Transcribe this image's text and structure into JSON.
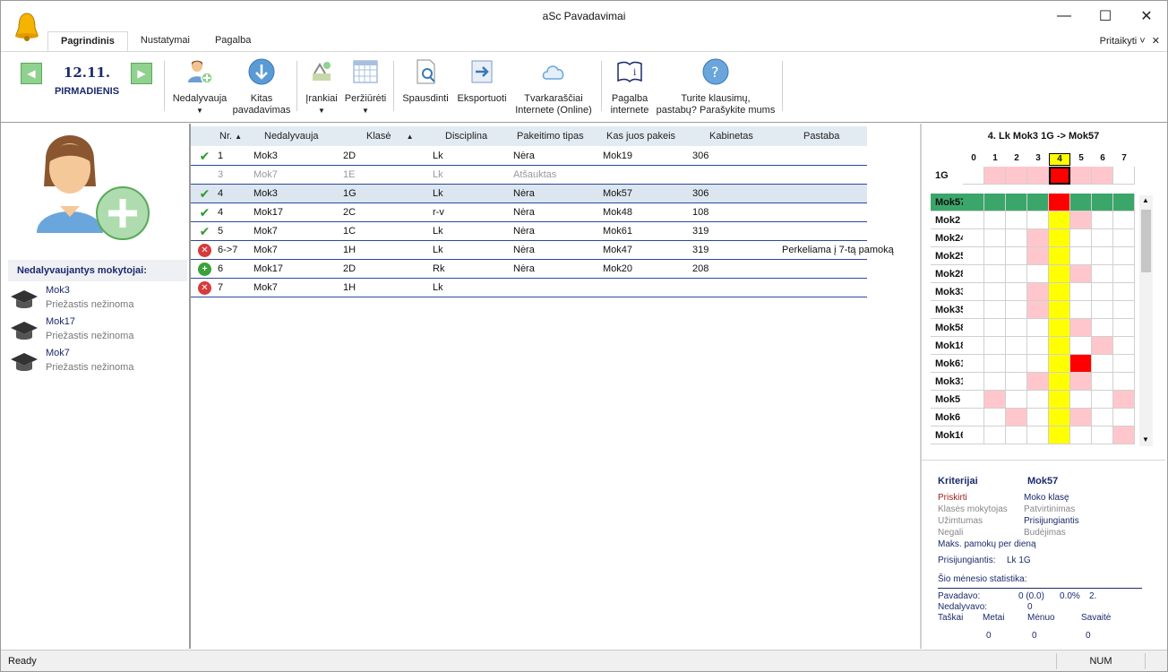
{
  "window": {
    "title": "aSc Pavadavimai"
  },
  "menu": {
    "tabs": [
      "Pagrindinis",
      "Nustatymai",
      "Pagalba"
    ],
    "customize": "Pritaikyti ˅"
  },
  "ribbon": {
    "date": "12.11.",
    "day": "PIRMADIENIS",
    "buttons": {
      "absent": "Nedalyvauja",
      "next_line1": "Kitas",
      "next_line2": "pavadavimas",
      "tools": "Įrankiai",
      "view": "Peržiūrėti",
      "print": "Spausdinti",
      "export": "Eksportuoti",
      "online_line1": "Tvarkaraščiai",
      "online_line2": "Internete (Online)",
      "help_line1": "Pagalba",
      "help_line2": "internete",
      "question_line1": "Turite klausimų,",
      "question_line2": "pastabų? Parašykite mums"
    }
  },
  "sidebar": {
    "title": "Nedalyvaujantys mokytojai:",
    "teachers": [
      {
        "name": "Mok3",
        "reason": "Priežastis nežinoma"
      },
      {
        "name": "Mok17",
        "reason": "Priežastis nežinoma"
      },
      {
        "name": "Mok7",
        "reason": "Priežastis nežinoma"
      }
    ]
  },
  "table": {
    "columns": [
      "Nr.",
      "Nedalyvauja",
      "Klasė",
      "Disciplina",
      "Pakeitimo tipas",
      "Kas juos pakeis",
      "Kabinetas",
      "Pastaba"
    ],
    "rows": [
      {
        "status": "ok",
        "nr": "1",
        "teacher": "Mok3",
        "class": "2D",
        "subject": "Lk",
        "type": "Nėra",
        "sub": "Mok19",
        "room": "306",
        "note": ""
      },
      {
        "status": "grey",
        "nr": "3",
        "teacher": "Mok7",
        "class": "1E",
        "subject": "Lk",
        "type": "Atšauktas",
        "sub": "",
        "room": "",
        "note": ""
      },
      {
        "status": "ok",
        "nr": "4",
        "teacher": "Mok3",
        "class": "1G",
        "subject": "Lk",
        "type": "Nėra",
        "sub": "Mok57",
        "room": "306",
        "note": ""
      },
      {
        "status": "ok",
        "nr": "4",
        "teacher": "Mok17",
        "class": "2C",
        "subject": "r-v",
        "type": "Nėra",
        "sub": "Mok48",
        "room": "108",
        "note": ""
      },
      {
        "status": "ok",
        "nr": "5",
        "teacher": "Mok7",
        "class": "1C",
        "subject": "Lk",
        "type": "Nėra",
        "sub": "Mok61",
        "room": "319",
        "note": ""
      },
      {
        "status": "no",
        "nr": "6->7",
        "teacher": "Mok7",
        "class": "1H",
        "subject": "Lk",
        "type": "Nėra",
        "sub": "Mok47",
        "room": "319",
        "note": "Perkeliama į 7-tą pamoką"
      },
      {
        "status": "add",
        "nr": "6",
        "teacher": "Mok17",
        "class": "2D",
        "subject": "Rk",
        "type": "Nėra",
        "sub": "Mok20",
        "room": "208",
        "note": ""
      },
      {
        "status": "no",
        "nr": "7",
        "teacher": "Mok7",
        "class": "1H",
        "subject": "Lk",
        "type": "",
        "sub": "",
        "room": "",
        "note": ""
      }
    ]
  },
  "grid": {
    "title": "4. Lk Mok3 1G -> Mok57",
    "periods": [
      "0",
      "1",
      "2",
      "3",
      "4",
      "5",
      "6",
      "7"
    ],
    "class_row": "1G",
    "teachers": [
      "Mok57",
      "Mok2",
      "Mok24",
      "Mok25",
      "Mok28",
      "Mok33",
      "Mok35",
      "Mok58",
      "Mok18",
      "Mok61",
      "Mok31",
      "Mok5",
      "Mok6",
      "Mok16"
    ]
  },
  "info": {
    "criteria": "Kriterijai",
    "teacher": "Mok57",
    "assigned": "Priskirti",
    "teaches_class": "Moko klasę",
    "class_teacher": "Klasės mokytojas",
    "confirmation": "Patvirtinimas",
    "busy": "Užimtumas",
    "joining": "Prisijungiantis",
    "cannot": "Negali",
    "duty": "Budėjimas",
    "max_lessons": "Maks. pamokų per dieną",
    "joining_label": "Prisijungiantis:",
    "joining_value": "Lk  1G",
    "month_stats": "Šio mėnesio statistika:",
    "substituted": "Pavadavo:",
    "substituted_value": "0 (0.0)",
    "percent": "0.0%",
    "rank": "2.",
    "absent": "Nedalyvavo:",
    "absent_value": "0",
    "points": "Taškai",
    "year": "Metai",
    "month": "Mėnuo",
    "week": "Savaitė",
    "year_v": "0",
    "month_v": "0",
    "week_v": "0"
  },
  "status": {
    "ready": "Ready",
    "num": "NUM"
  }
}
